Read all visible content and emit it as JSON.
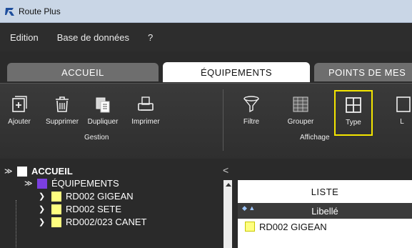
{
  "window": {
    "title": "Route Plus"
  },
  "menu": [
    "Edition",
    "Base de données",
    "?"
  ],
  "tabs": {
    "accueil": "ACCUEIL",
    "equipements": "ÉQUIPEMENTS",
    "points": "POINTS DE MES"
  },
  "ribbon": {
    "gestion": {
      "group_label": "Gestion",
      "ajouter": "Ajouter",
      "supprimer": "Supprimer",
      "dupliquer": "Dupliquer",
      "imprimer": "Imprimer"
    },
    "affichage": {
      "group_label": "Affichage",
      "filtre": "Filtre",
      "grouper": "Grouper",
      "type": "Type",
      "partial": "L"
    }
  },
  "tree": {
    "root_label": "ACCUEIL",
    "equipements_label": "ÉQUIPEMENTS",
    "items": [
      "RD002 GIGEAN",
      "RD002 SETE",
      "RD002/023 CANET"
    ]
  },
  "list": {
    "title": "LISTE",
    "column": "Libellé",
    "rows": [
      "RD002 GIGEAN"
    ]
  },
  "colors": {
    "accent_yellow": "#f4e600",
    "purple": "#7b3fe0",
    "square_yellow": "#ffff80"
  }
}
